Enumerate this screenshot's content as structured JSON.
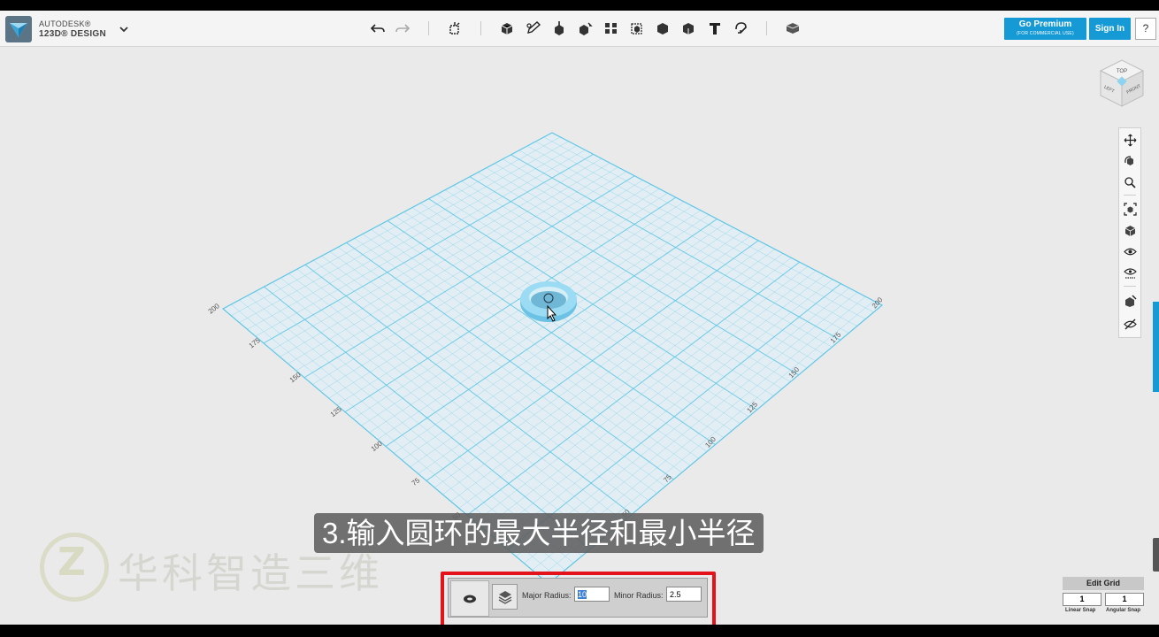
{
  "brand": {
    "line1": "AUTODESK®",
    "line2": "123D® DESIGN"
  },
  "header": {
    "premium_label": "Go Premium",
    "premium_sub": "(FOR COMMERCIAL USE)",
    "signin_label": "Sign In",
    "help_label": "?"
  },
  "viewcube": {
    "top": "TOP",
    "left": "LEFT",
    "front": "FRONT"
  },
  "grid": {
    "left_axis_labels": [
      "200",
      "175",
      "150",
      "125",
      "100",
      "75",
      "50"
    ],
    "right_axis_labels": [
      "200",
      "175",
      "150",
      "125",
      "100",
      "75",
      "50"
    ]
  },
  "subtitle": "3.输入圆环的最大半径和最小半径",
  "watermark": {
    "text": "华科智造三维",
    "logo_letter": "Z"
  },
  "torus_panel": {
    "major_label": "Major Radius:",
    "major_value": "10",
    "minor_label": "Minor Radius:",
    "minor_value": "2.5"
  },
  "edit_grid": {
    "button": "Edit Grid",
    "linear_value": "1",
    "angular_value": "1",
    "linear_label": "Linear Snap",
    "angular_label": "Angular Snap"
  },
  "colors": {
    "accent": "#169ad6",
    "grid": "#5fc6e6",
    "highlight": "#e3121b",
    "torus": "#8fd6f2"
  }
}
